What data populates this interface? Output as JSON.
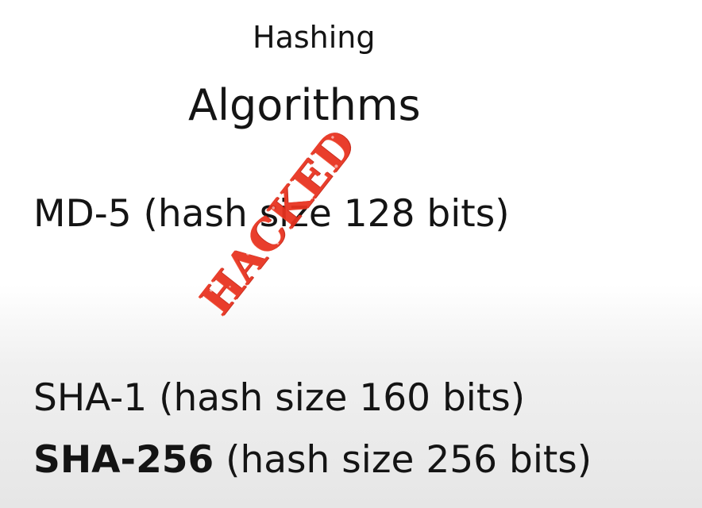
{
  "title": {
    "line1": "Hashing",
    "line2": "Algorithms"
  },
  "items": [
    {
      "prefix": "MD-5",
      "detail": " (hash size 128 bits)"
    },
    {
      "prefix": "SHA-1",
      "detail": " (hash size 160 bits)"
    },
    {
      "prefix": "SHA-256",
      "detail": " (hash size 256 bits)"
    }
  ],
  "stamp": {
    "text": "HACKED",
    "color": "#e8321f"
  }
}
